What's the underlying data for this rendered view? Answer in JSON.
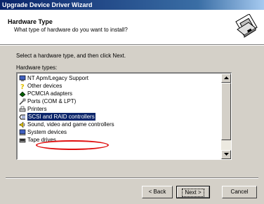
{
  "window": {
    "title": "Upgrade Device Driver Wizard"
  },
  "header": {
    "title": "Hardware Type",
    "subtitle": "What type of hardware do you want to install?",
    "icon": "wizard-hardware-icon"
  },
  "main": {
    "instruction": "Select a hardware type, and then click Next.",
    "list_label": "Hardware types:",
    "items": [
      {
        "label": "NT Apm/Legacy Support",
        "icon": "computer-icon"
      },
      {
        "label": "Other devices",
        "icon": "question-icon"
      },
      {
        "label": "PCMCIA adapters",
        "icon": "pcmcia-icon"
      },
      {
        "label": "Ports (COM & LPT)",
        "icon": "port-icon"
      },
      {
        "label": "Printers",
        "icon": "printer-icon"
      },
      {
        "label": "SCSI and RAID controllers",
        "icon": "scsi-icon",
        "selected": true
      },
      {
        "label": "Sound, video and game controllers",
        "icon": "sound-icon"
      },
      {
        "label": "System devices",
        "icon": "system-icon"
      },
      {
        "label": "Tape drives",
        "icon": "tape-icon"
      }
    ]
  },
  "buttons": {
    "back": "< Back",
    "next": "Next >",
    "cancel": "Cancel"
  },
  "colors": {
    "titlebar": "#0a246a",
    "selection": "#0a246a",
    "highlight_ellipse": "#e01010",
    "dialog_bg": "#d4d0c8"
  }
}
